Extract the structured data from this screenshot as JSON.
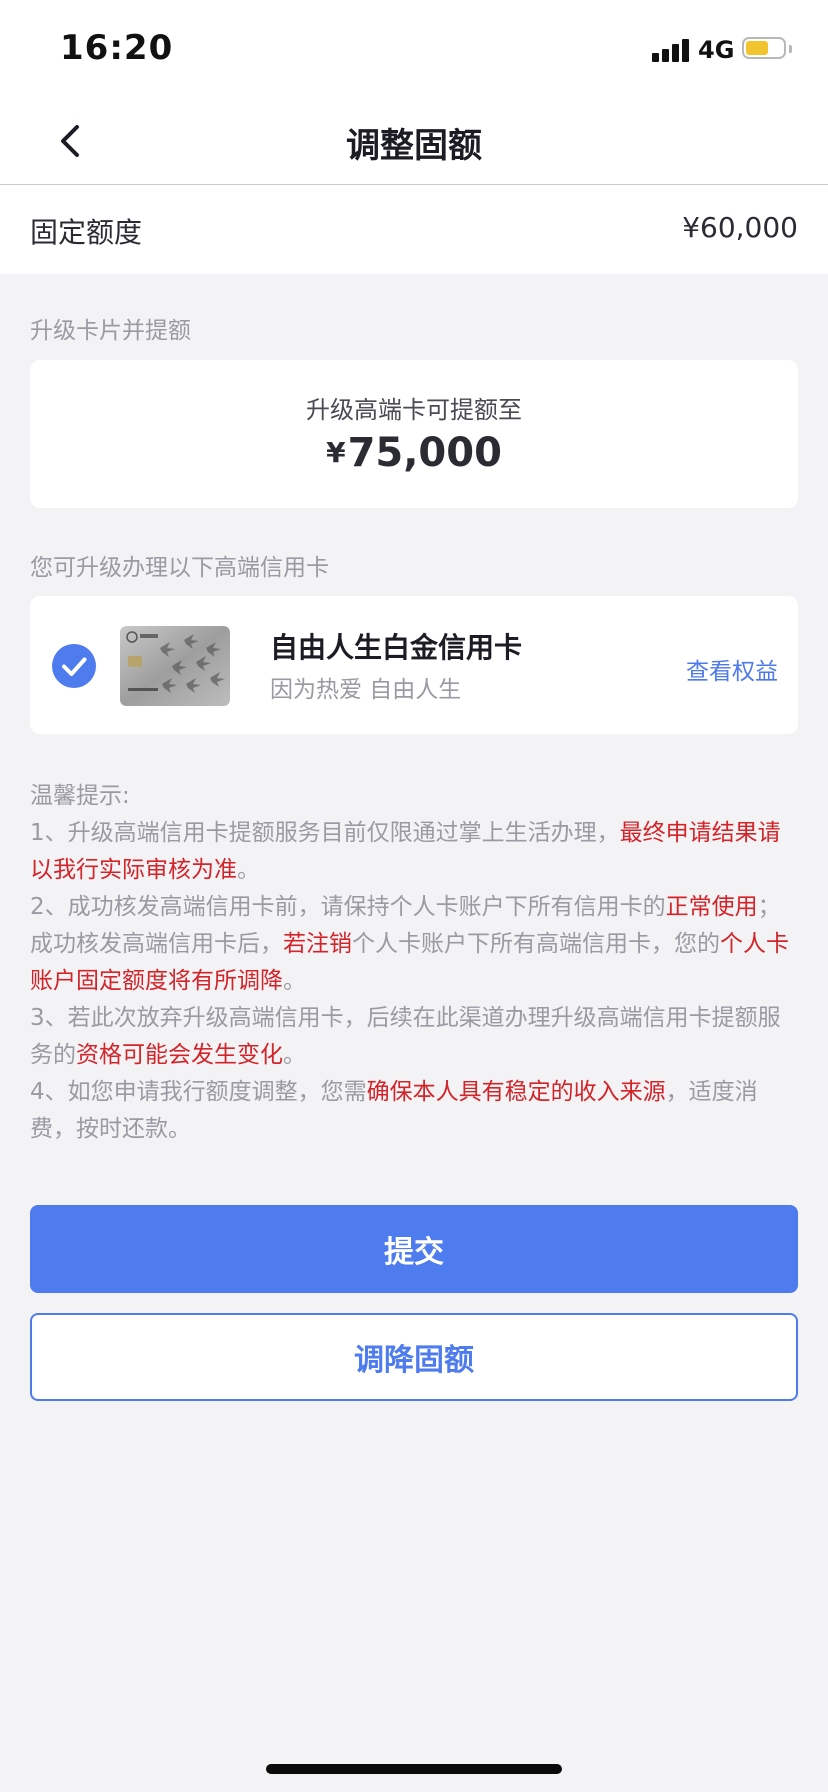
{
  "status_bar": {
    "time": "16:20",
    "network": "4G",
    "battery_level": 0.6
  },
  "header": {
    "title": "调整固额"
  },
  "fixed_quota": {
    "label": "固定额度",
    "value": "¥60,000"
  },
  "upgrade_section": {
    "label": "升级卡片并提额",
    "caption": "升级高端卡可提额至",
    "currency": "¥",
    "amount": "75,000"
  },
  "cards_section": {
    "label": "您可升级办理以下高端信用卡",
    "card": {
      "name": "自由人生白金信用卡",
      "slogan": "因为热爱 自由人生",
      "action": "查看权益",
      "selected": true
    }
  },
  "tips": {
    "title": "温馨提示:",
    "t1_a": "1、升级高端信用卡提额服务目前仅限通过掌上生活办理，",
    "t1_b": "最终申请结果请以我行实际审核为准",
    "t1_c": "。",
    "t2_a": "2、成功核发高端信用卡前，请保持个人卡账户下所有信用卡的",
    "t2_b": "正常使用",
    "t2_c": "；成功核发高端信用卡后，",
    "t2_d": "若注销",
    "t2_e": "个人卡账户下所有高端信用卡，您的",
    "t2_f": "个人卡账户固定额度将有所调降",
    "t2_g": "。",
    "t3_a": "3、若此次放弃升级高端信用卡，后续在此渠道办理升级高端信用卡提额服务的",
    "t3_b": "资格可能会发生变化",
    "t3_c": "。",
    "t4_a": "4、如您申请我行额度调整，您需",
    "t4_b": "确保本人具有稳定的收入来源",
    "t4_c": "，适度消费，按时还款。"
  },
  "buttons": {
    "submit": "提交",
    "lower_quota": "调降固额"
  },
  "colors": {
    "accent": "#4e7bee",
    "highlight": "#d3242a",
    "background": "#f3f3f5"
  }
}
